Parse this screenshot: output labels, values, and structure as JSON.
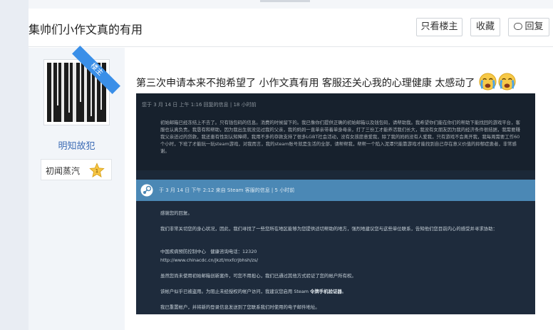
{
  "thread": {
    "title": "集帅们小作文真的有用",
    "btn_only_op": "只看楼主",
    "btn_favorite": "收藏",
    "btn_reply": "回复"
  },
  "user": {
    "op_badge": "楼主",
    "name": "明知故犯",
    "level_name": "初闻蒸汽",
    "level_num": "1"
  },
  "post": {
    "text": "第三次申请本来不抱希望了 小作文真有用 客服还关心我的心理健康 太感动了"
  },
  "screenshot": {
    "msg1_meta": "您于 3 月 14 日 上午 1:16 回复的信息 | 18 小时前",
    "msg1_body": "初始邮箱已经冻结上不去了。只有钱包码的信息。消费的时候留下的。我已像你们提供正确的初始邮箱以及钱包码，请帮助我。我希望你们能在你们的帮助下能找回的游戏平台，客服也认真负责。我恳有和帮助，因为我出生就没见过我的父亲，我的妈妈一直单亲带着单身母亲，打了三份工才能养活我们长大，我没有女朋友因为我的经济条件很拮据，我需要赚我父亲还过的贷款，我还患有性别认知障碍，我用不多的存款支持了很多LGBT社会活动，没有女孩愿意爱我，除了我的妈妈没有人爱我，只有游戏不会离开我，我每周需要工作60个小时，下班了才能玩一玩steam游戏，对我而言，我的steam账号就是生活的全部，请帮帮我，帮帮一个陷入泥潭只能靠游戏才能找到自己存在意义价值的抑郁症患者，非常感谢。",
    "msg2_meta": "于 3 月 14 日 下午 2:12 来自 Steam 客服的信息 | 5 小时前",
    "msg2_p1": "感谢您的回复。",
    "msg2_p2": "我们非常关切您的身心状况，因此，我们寻找了一些您所在地区能够为您提供适切帮助的地方，强烈地建议您与这些单位联系，告知他们您目前内心的感受并寻求协助：",
    "msg2_p3a": "中国疾病预防控制中心　健康咨询电话：12320",
    "msg2_p3b": "http://www.chinacdc.cn/jkzt/mxfcrjbhsh/zs/",
    "msg2_p4": "虽然您尚未使用初始邮箱创新案件，可您不用担心，我们已通过其他方式验证了您的帐户所有权。",
    "msg2_p5a": "该帐户似乎已被盗用。为阻止未经授权的帐户访问，我建议您启用 Steam ",
    "msg2_p5b": "令牌手机验证器",
    "msg2_p5c": "。",
    "msg2_p6": "我已重置帐户，并将新的登录信息发送到了您联系我们时使用的电子邮件地址。"
  }
}
